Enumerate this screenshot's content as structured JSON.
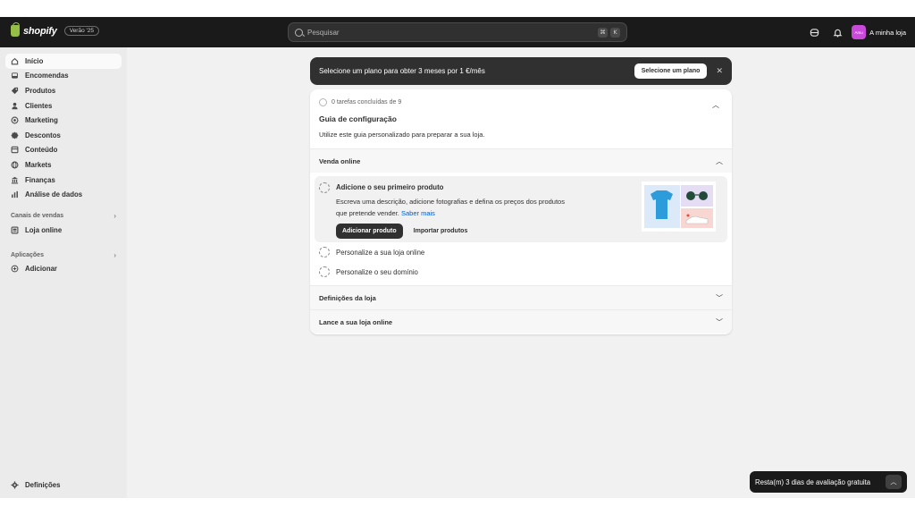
{
  "topbar": {
    "logo_text": "shopify",
    "version_badge": "Verão '25",
    "search_placeholder": "Pesquisar",
    "shortcut_keys": [
      "⌘",
      "K"
    ],
    "store_name": "A minha loja",
    "avatar_initials": "Amu",
    "avatar_color": "#c74ad8"
  },
  "sidebar": {
    "items": [
      {
        "label": "Início",
        "icon": "home-icon",
        "active": true
      },
      {
        "label": "Encomendas",
        "icon": "inbox-icon"
      },
      {
        "label": "Produtos",
        "icon": "tag-icon"
      },
      {
        "label": "Clientes",
        "icon": "person-icon"
      },
      {
        "label": "Marketing",
        "icon": "target-icon"
      },
      {
        "label": "Descontos",
        "icon": "discount-icon"
      },
      {
        "label": "Conteúdo",
        "icon": "content-icon"
      },
      {
        "label": "Markets",
        "icon": "globe-icon"
      },
      {
        "label": "Finanças",
        "icon": "bank-icon"
      },
      {
        "label": "Análise de dados",
        "icon": "chart-icon"
      }
    ],
    "sales_channels_label": "Canais de vendas",
    "online_store_label": "Loja online",
    "apps_label": "Aplicações",
    "add_label": "Adicionar",
    "settings_label": "Definições"
  },
  "banner": {
    "text": "Selecione um plano para obter 3 meses por 1 €/mês",
    "button_label": "Selecione um plano"
  },
  "guide": {
    "progress": "0 tarefas concluídas de 9",
    "title": "Guia de configuração",
    "description": "Utilize este guia personalizado para preparar a sua loja.",
    "section_online": "Venda online",
    "task_active": {
      "title": "Adicione o seu primeiro produto",
      "description": "Escreva uma descrição, adicione fotografias e defina os preços dos produtos que pretende vender.",
      "link": "Saber mais",
      "primary_button": "Adicionar produto",
      "secondary_button": "Importar produtos"
    },
    "task_customize": "Personalize a sua loja online",
    "task_domain": "Personalize o seu domínio",
    "section_settings": "Definições da loja",
    "section_launch": "Lance a sua loja online"
  },
  "trial": {
    "text": "Resta(m) 3 dias de avaliação gratuita"
  },
  "colors": {
    "topbar": "#1a1a1a",
    "sidebar": "#ebebeb",
    "main": "#f1f1f1",
    "link": "#005bd3",
    "logo_green": "#95bf47"
  }
}
